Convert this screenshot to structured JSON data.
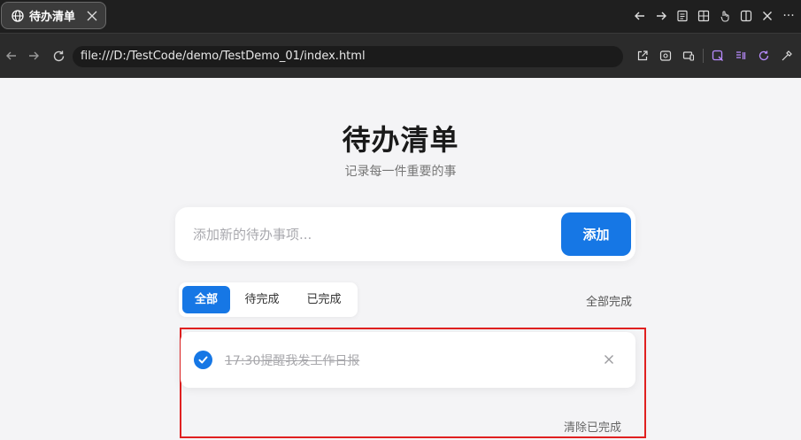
{
  "browser": {
    "tab_title": "待办清单",
    "url": "file:///D:/TestCode/demo/TestDemo_01/index.html",
    "window_more": "···"
  },
  "page": {
    "title": "待办清单",
    "subtitle": "记录每一件重要的事"
  },
  "add_form": {
    "placeholder": "添加新的待办事项...",
    "button_label": "添加"
  },
  "filters": {
    "items": [
      {
        "label": "全部",
        "active": true
      },
      {
        "label": "待完成",
        "active": false
      },
      {
        "label": "已完成",
        "active": false
      }
    ],
    "complete_all_label": "全部完成"
  },
  "todos": [
    {
      "text": "17:30提醒我发工作日报",
      "done": true
    }
  ],
  "footer": {
    "clear_done_label": "清除已完成"
  },
  "colors": {
    "accent": "#1677e5",
    "highlight_border": "#e02020"
  }
}
